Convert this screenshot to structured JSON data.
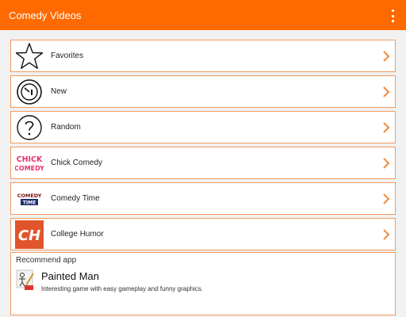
{
  "appbar": {
    "title": "Comedy Videos",
    "menu_icon": "overflow-menu-icon"
  },
  "colors": {
    "accent": "#ff6a00",
    "row_border": "#f39a5f"
  },
  "menu": {
    "items": [
      {
        "label": "Favorites",
        "icon": "star-icon"
      },
      {
        "label": "New",
        "icon": "clock-icon"
      },
      {
        "label": "Random",
        "icon": "question-icon"
      },
      {
        "label": "Chick Comedy",
        "icon": "chick-comedy-logo",
        "logo_text": [
          "CHICK",
          "COMEDY"
        ]
      },
      {
        "label": "Comedy Time",
        "icon": "comedy-time-logo",
        "logo_text": [
          "COMEDY",
          "TIME"
        ]
      },
      {
        "label": "College Humor",
        "icon": "college-humor-logo",
        "logo_text": "CH"
      }
    ]
  },
  "recommend": {
    "heading": "Recommend app",
    "app_name": "Painted Man",
    "app_description": "Interesting game with easy gameplay and funny graphics."
  }
}
